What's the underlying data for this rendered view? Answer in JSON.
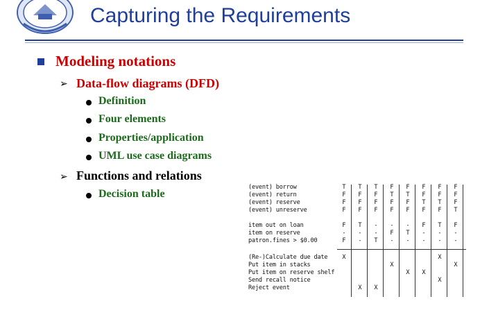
{
  "slide": {
    "title": "Capturing the Requirements",
    "level1": "Modeling notations",
    "dfd": "Data-flow diagrams (DFD)",
    "dfd_items": [
      "Definition",
      "Four elements",
      "Properties/application",
      "UML use case diagrams"
    ],
    "functions": "Functions and relations",
    "decision_table_label": "Decision table"
  },
  "colors": {
    "title": "#1f3f9a",
    "heading": "#cc0000",
    "bullet_text": "#1c6b1c"
  },
  "decision_table": {
    "conditions": [
      "(event) borrow",
      "(event) return",
      "(event) reserve",
      "(event) unreserve",
      "item out on loan",
      "item on reserve",
      "patron.fines > $0.00"
    ],
    "actions": [
      "(Re-)Calculate due date",
      "Put item in stacks",
      "Put item on reserve shelf",
      "Send recall notice",
      "Reject event"
    ],
    "condition_entries": [
      [
        "T",
        "T",
        "T",
        "F",
        "F",
        "F",
        "F",
        "F"
      ],
      [
        "F",
        "F",
        "F",
        "T",
        "T",
        "F",
        "F",
        "F"
      ],
      [
        "F",
        "F",
        "F",
        "F",
        "F",
        "T",
        "T",
        "F"
      ],
      [
        "F",
        "F",
        "F",
        "F",
        "F",
        "F",
        "F",
        "T"
      ],
      [
        "F",
        "T",
        "-",
        "-",
        "-",
        "F",
        "T",
        "F"
      ],
      [
        "-",
        "-",
        "-",
        "F",
        "T",
        "-",
        "-",
        "-"
      ],
      [
        "F",
        "-",
        "T",
        "-",
        "-",
        "-",
        "-",
        "-"
      ]
    ],
    "action_entries": [
      [
        "X",
        "",
        "",
        "",
        "",
        "",
        "X",
        ""
      ],
      [
        "",
        "",
        "",
        "X",
        "",
        "",
        "",
        "X"
      ],
      [
        "",
        "",
        "",
        "",
        "X",
        "X",
        "",
        ""
      ],
      [
        "",
        "",
        "",
        "",
        "",
        "",
        "X",
        ""
      ],
      [
        "",
        "X",
        "X",
        "",
        "",
        "",
        "",
        ""
      ]
    ]
  }
}
